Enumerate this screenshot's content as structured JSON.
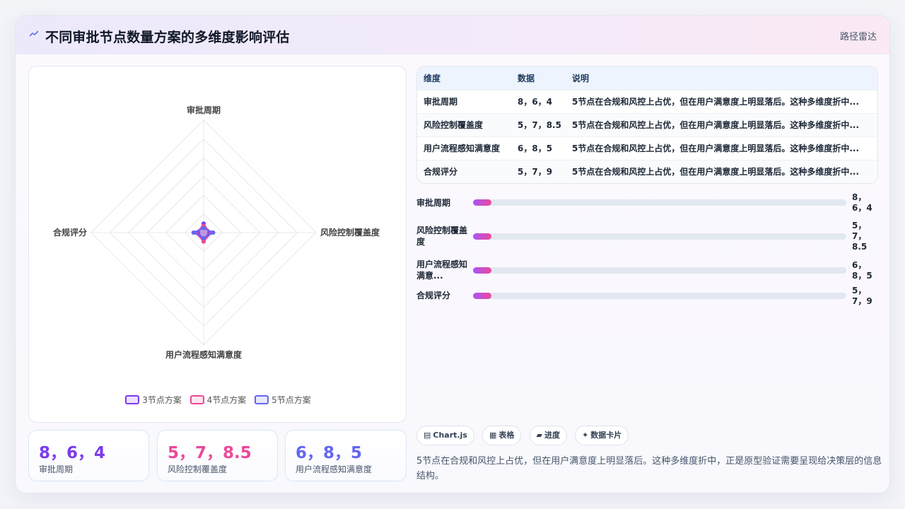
{
  "header": {
    "title": "不同审批节点数量方案的多维度影响评估",
    "tag": "路径雷达"
  },
  "colors": {
    "series_3": "#7c3aed",
    "series_4": "#ec4899",
    "series_5": "#6366f1",
    "bar_gradient_start": "#a855f7",
    "bar_gradient_end": "#ec4899"
  },
  "chart_data": {
    "type": "radar",
    "axes": [
      "审批周期",
      "风险控制覆盖度",
      "用户流程感知满意度",
      "合规评分"
    ],
    "series": [
      {
        "name": "3节点方案",
        "values": [
          8,
          5,
          6,
          5
        ]
      },
      {
        "name": "4节点方案",
        "values": [
          6,
          7,
          8,
          7
        ]
      },
      {
        "name": "5节点方案",
        "values": [
          4,
          8.5,
          5,
          9
        ]
      }
    ],
    "rmax": 100,
    "rings": 6,
    "legend": "bottom"
  },
  "table": {
    "headers": [
      "维度",
      "数据",
      "说明"
    ],
    "rows": [
      {
        "dim": "审批周期",
        "data": "8，6，4",
        "desc": "5节点在合规和风控上占优，但在用户满意度上明显落后。这种多维度折中..."
      },
      {
        "dim": "风险控制覆盖度",
        "data": "5，7，8.5",
        "desc": "5节点在合规和风控上占优，但在用户满意度上明显落后。这种多维度折中..."
      },
      {
        "dim": "用户流程感知满意度",
        "data": "6，8，5",
        "desc": "5节点在合规和风控上占优，但在用户满意度上明显落后。这种多维度折中..."
      },
      {
        "dim": "合规评分",
        "data": "5，7，9",
        "desc": "5节点在合规和风控上占优，但在用户满意度上明显落后。这种多维度折中..."
      }
    ]
  },
  "bars": [
    {
      "label": "审批周期",
      "value": "8，6，4",
      "fill_pct": 5
    },
    {
      "label": "风险控制覆盖度",
      "value": "5，7，8.5",
      "fill_pct": 5
    },
    {
      "label": "用户流程感知满意...",
      "value": "6，8，5",
      "fill_pct": 5
    },
    {
      "label": "合规评分",
      "value": "5，7，9",
      "fill_pct": 5
    }
  ],
  "stats": [
    {
      "value": "8，6，4",
      "label": "审批周期",
      "color": "#7c3aed"
    },
    {
      "value": "5，7，8.5",
      "label": "风险控制覆盖度",
      "color": "#ec4899"
    },
    {
      "value": "6，8，5",
      "label": "用户流程感知满意度",
      "color": "#6366f1"
    }
  ],
  "chips": [
    {
      "icon": "▤",
      "label": "Chart.js"
    },
    {
      "icon": "▦",
      "label": "表格"
    },
    {
      "icon": "▰",
      "label": "进度"
    },
    {
      "icon": "✦",
      "label": "数据卡片"
    }
  ],
  "note": "5节点在合规和风控上占优，但在用户满意度上明显落后。这种多维度折中，正是原型验证需要呈现给决策层的信息结构。"
}
